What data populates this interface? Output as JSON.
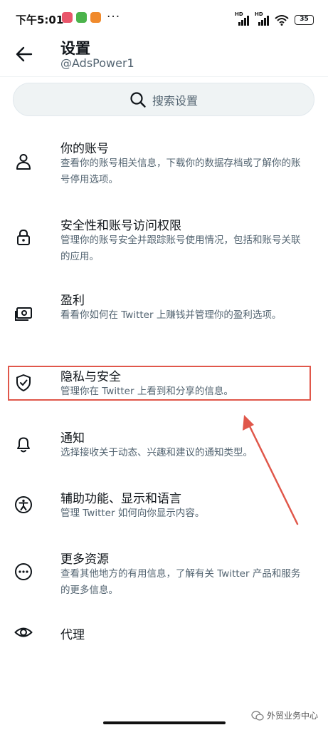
{
  "status_bar": {
    "time": "下午5:01",
    "more": "···",
    "battery": "35",
    "signal_label": "HD"
  },
  "header": {
    "title": "设置",
    "subtitle": "@AdsPower1"
  },
  "search": {
    "placeholder": "搜索设置"
  },
  "settings": [
    {
      "icon": "person-icon",
      "title": "你的账号",
      "description": "查看你的账号相关信息，下载你的数据存档或了解你的账号停用选项。"
    },
    {
      "icon": "lock-icon",
      "title": "安全性和账号访问权限",
      "description": "管理你的账号安全并跟踪账号使用情况，包括和账号关联的应用。"
    },
    {
      "icon": "money-icon",
      "title": "盈利",
      "description": "看看你如何在 Twitter 上赚钱并管理你的盈利选项。"
    },
    {
      "icon": "shield-check-icon",
      "title": "隐私与安全",
      "description": "管理你在 Twitter 上看到和分享的信息。"
    },
    {
      "icon": "bell-icon",
      "title": "通知",
      "description": "选择接收关于动态、兴趣和建议的通知类型。"
    },
    {
      "icon": "accessibility-icon",
      "title": "辅助功能、显示和语言",
      "description": "管理 Twitter 如何向你显示内容。"
    },
    {
      "icon": "more-circle-icon",
      "title": "更多资源",
      "description": "查看其他地方的有用信息，了解有关 Twitter 产品和服务的更多信息。"
    },
    {
      "icon": "eye-icon",
      "title": "代理",
      "description": ""
    }
  ],
  "watermark": "外贸业务中心",
  "colors": {
    "highlight": "#e0574a",
    "text_primary": "#0f1419",
    "text_secondary": "#536471",
    "search_bg": "#eff3f4"
  }
}
